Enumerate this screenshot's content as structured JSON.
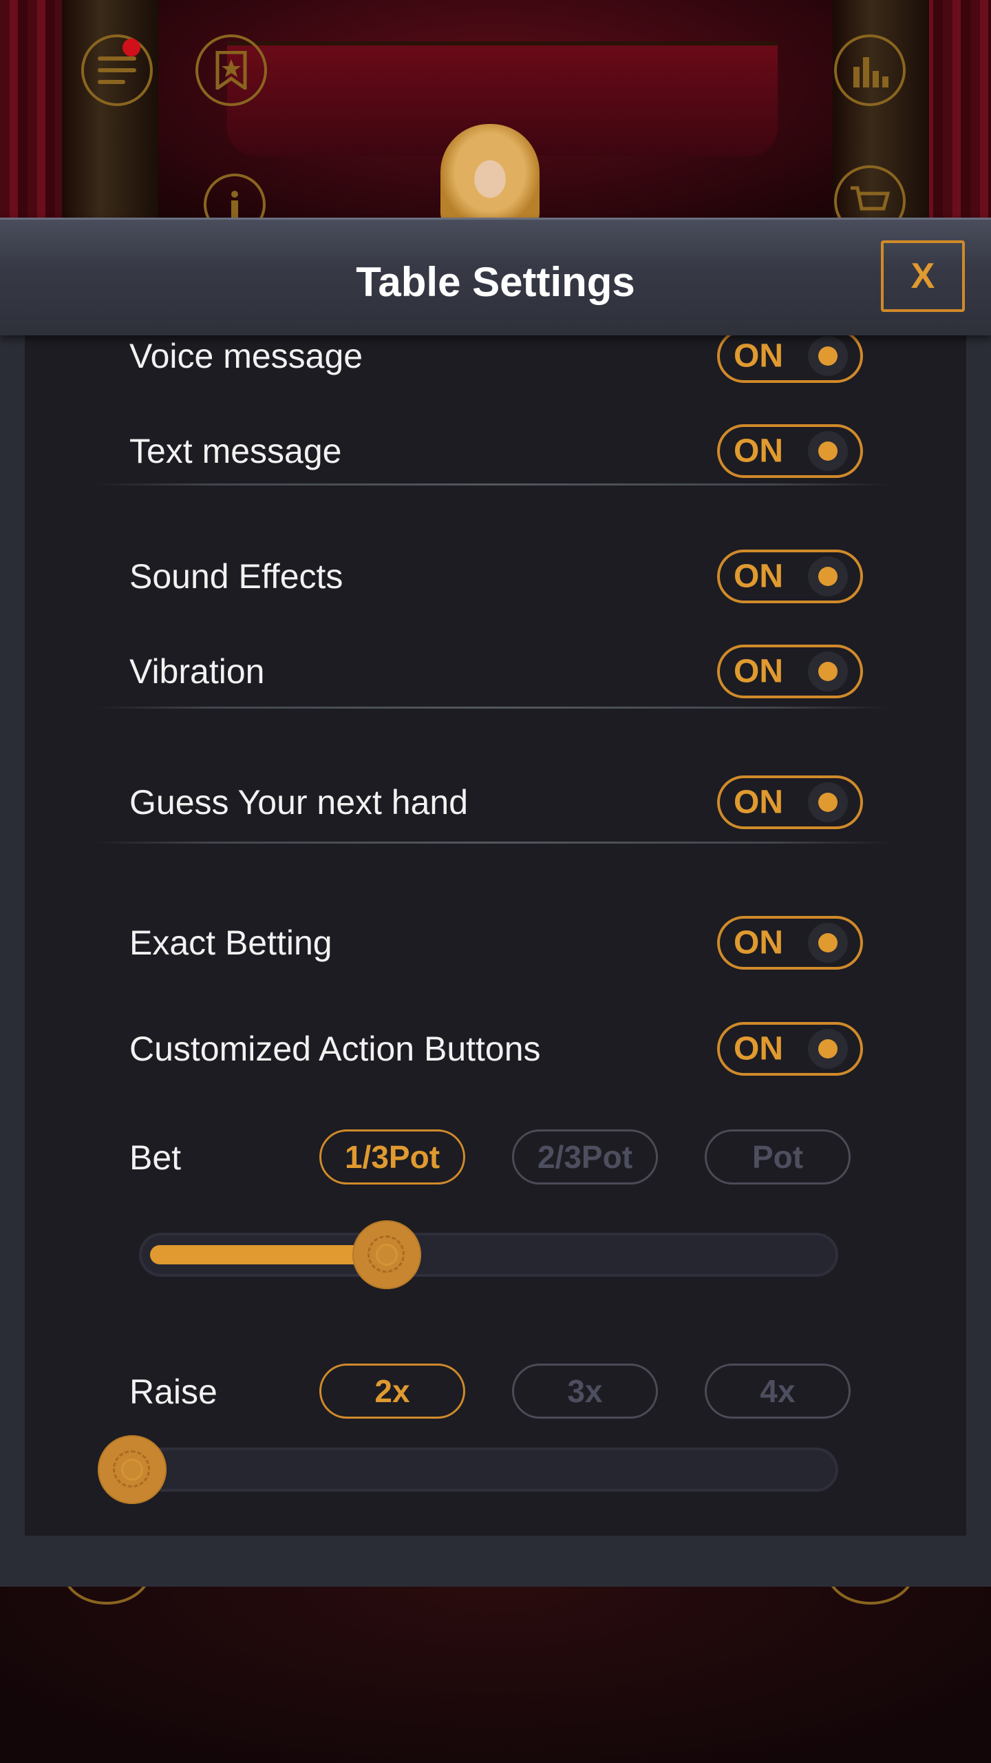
{
  "modal": {
    "title": "Table Settings",
    "close_label": "X"
  },
  "settings": [
    {
      "label": "Voice message",
      "state": "ON"
    },
    {
      "label": "Text message",
      "state": "ON"
    },
    {
      "label": "Sound Effects",
      "state": "ON"
    },
    {
      "label": "Vibration",
      "state": "ON"
    },
    {
      "label": "Guess Your next hand",
      "state": "ON"
    },
    {
      "label": "Exact Betting",
      "state": "ON"
    },
    {
      "label": "Customized Action Buttons",
      "state": "ON"
    }
  ],
  "bet": {
    "label": "Bet",
    "options": [
      "1/3Pot",
      "2/3Pot",
      "Pot"
    ],
    "selected": "1/3Pot",
    "slider_level": 0.35
  },
  "raise": {
    "label": "Raise",
    "options": [
      "2x",
      "3x",
      "4x"
    ],
    "selected": "2x",
    "slider_level": 0.0
  },
  "colors": {
    "accent": "#e09a30",
    "panel": "#1c1c22",
    "modal": "#2b2d36",
    "inactive": "#4d4e5e"
  },
  "icons": {
    "top_left": "menu-icon",
    "top_second": "bookmark-star-icon",
    "top_right": "bar-chart-icon",
    "info": "info-icon",
    "shop": "shopping-cart-icon"
  }
}
